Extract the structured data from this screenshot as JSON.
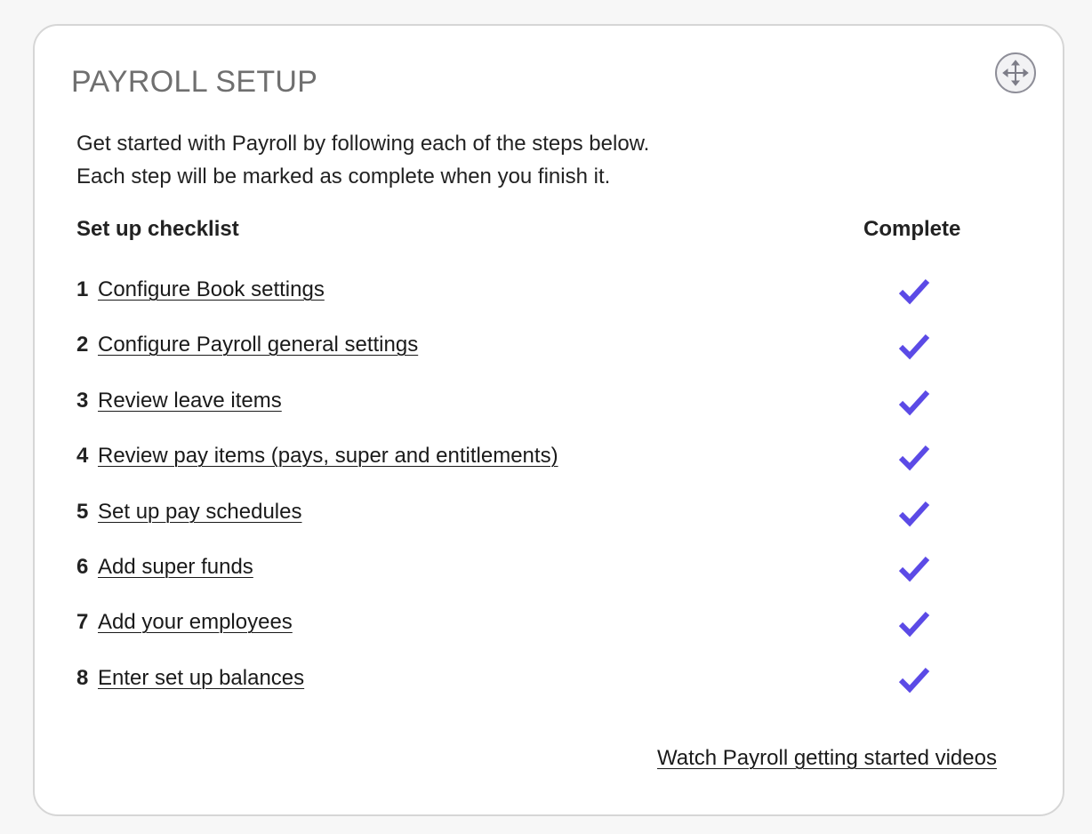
{
  "widget": {
    "title": "PAYROLL SETUP",
    "move_icon": "move-arrows-icon",
    "intro_line_1": "Get started with Payroll by following each of the steps below.",
    "intro_line_2": "Each step will be marked as complete when you finish it.",
    "checklist_header": "Set up checklist",
    "complete_header": "Complete",
    "check_color": "#5b4ae6",
    "steps": [
      {
        "number": "1",
        "label": "Configure Book settings",
        "complete": true
      },
      {
        "number": "2",
        "label": "Configure Payroll general settings",
        "complete": true
      },
      {
        "number": "3",
        "label": "Review leave items",
        "complete": true
      },
      {
        "number": "4",
        "label": "Review pay items (pays, super and entitlements)",
        "complete": true
      },
      {
        "number": "5",
        "label": "Set up pay schedules",
        "complete": true
      },
      {
        "number": "6",
        "label": "Add super funds",
        "complete": true
      },
      {
        "number": "7",
        "label": "Add your employees",
        "complete": true
      },
      {
        "number": "8",
        "label": "Enter set up balances",
        "complete": true
      }
    ],
    "videos_link": "Watch Payroll getting started videos"
  }
}
